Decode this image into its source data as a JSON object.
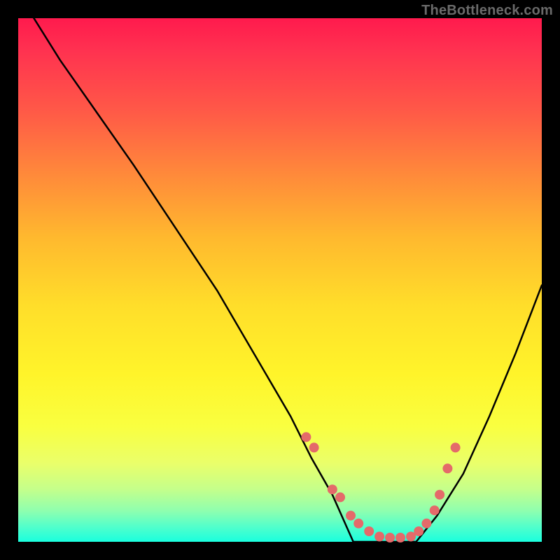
{
  "watermark": "TheBottleneck.com",
  "chart_data": {
    "type": "line",
    "title": "",
    "xlabel": "",
    "ylabel": "",
    "xlim": [
      0,
      100
    ],
    "ylim": [
      0,
      100
    ],
    "series": [
      {
        "name": "curve",
        "x": [
          0,
          3,
          8,
          15,
          22,
          30,
          38,
          45,
          52,
          56,
          60,
          64,
          68,
          72,
          76,
          80,
          85,
          90,
          95,
          100
        ],
        "values": [
          105,
          100,
          92,
          82,
          72,
          60,
          48,
          36,
          24,
          16,
          9,
          4,
          1,
          0,
          1,
          5,
          13,
          24,
          36,
          49
        ]
      }
    ],
    "flat_bottom_range": [
      64,
      76
    ],
    "markers": {
      "name": "dots",
      "color": "#e46a6a",
      "x": [
        55,
        56.5,
        60,
        61.5,
        63.5,
        65,
        67,
        69,
        71,
        73,
        75,
        76.5,
        78,
        79.5,
        80.5,
        82,
        83.5
      ],
      "values": [
        20,
        18,
        10,
        8.5,
        5,
        3.5,
        2,
        1,
        0.8,
        0.8,
        1,
        2,
        3.5,
        6,
        9,
        14,
        18
      ]
    }
  }
}
